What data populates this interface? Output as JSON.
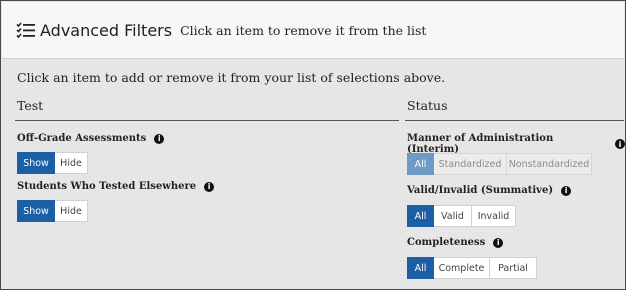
{
  "header": {
    "title": "Advanced Filters",
    "subtitle": "Click an item to remove it from the list"
  },
  "intro": "Click an item to add or remove it from your list of selections above.",
  "columns": {
    "test": {
      "title": "Test",
      "filters": [
        {
          "label": "Off-Grade Assessments",
          "options": [
            "Show",
            "Hide"
          ],
          "selected": "Show"
        },
        {
          "label": "Students Who Tested Elsewhere",
          "options": [
            "Show",
            "Hide"
          ],
          "selected": "Show"
        }
      ]
    },
    "status": {
      "title": "Status",
      "filters": [
        {
          "label": "Manner of Administration (Interim)",
          "options": [
            "All",
            "Standardized",
            "Nonstandardized"
          ],
          "selected": "All",
          "disabled": true
        },
        {
          "label": "Valid/Invalid (Summative)",
          "options": [
            "All",
            "Valid",
            "Invalid"
          ],
          "selected": "All"
        },
        {
          "label": "Completeness",
          "options": [
            "All",
            "Complete",
            "Partial"
          ],
          "selected": "All"
        }
      ]
    }
  },
  "info_glyph": "i",
  "icons": {
    "header": "checklist-icon",
    "info": "info-icon"
  },
  "colors": {
    "active": "#1d5fa6",
    "active_disabled": "#6f9ac6",
    "background": "#e6e6e6"
  }
}
